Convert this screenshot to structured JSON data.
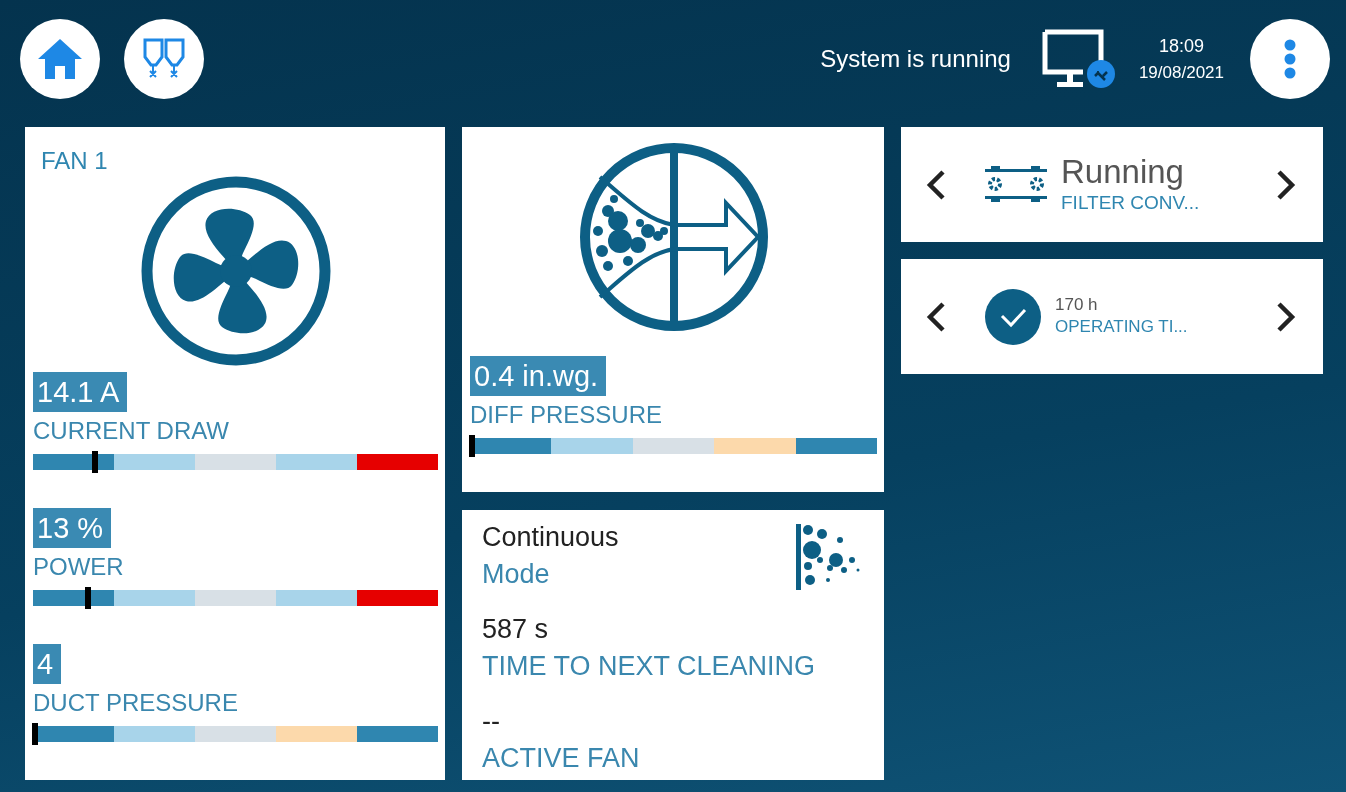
{
  "header": {
    "status": "System is running",
    "time": "18:09",
    "date": "19/08/2021"
  },
  "fan_card": {
    "title": "FAN 1",
    "readings": [
      {
        "value": "14.1 A",
        "label": "CURRENT DRAW",
        "level": 0.147,
        "zones": [
          {
            "color": "#2f86b0"
          },
          {
            "color": "#a8d4ea"
          },
          {
            "color": "#d8e0e6"
          },
          {
            "color": "#a8d4ea"
          },
          {
            "color": "#e60000"
          }
        ]
      },
      {
        "value": "13 %",
        "label": "POWER",
        "level": 0.13,
        "zones": [
          {
            "color": "#2f86b0"
          },
          {
            "color": "#a8d4ea"
          },
          {
            "color": "#d8e0e6"
          },
          {
            "color": "#a8d4ea"
          },
          {
            "color": "#e60000"
          }
        ]
      },
      {
        "value": "4",
        "label": "DUCT PRESSURE",
        "level": 0.0,
        "zones": [
          {
            "color": "#2f86b0"
          },
          {
            "color": "#a8d4ea"
          },
          {
            "color": "#d8e0e6"
          },
          {
            "color": "#fcd9ab"
          },
          {
            "color": "#2f86b0"
          }
        ]
      }
    ]
  },
  "pressure_card": {
    "value": "0.4 in.wg.",
    "label": "DIFF PRESSURE",
    "level": 0.0,
    "zones": [
      {
        "color": "#2f86b0"
      },
      {
        "color": "#a8d4ea"
      },
      {
        "color": "#d8e0e6"
      },
      {
        "color": "#fcd9ab"
      },
      {
        "color": "#2f86b0"
      }
    ]
  },
  "cleaning_card": {
    "items": [
      {
        "value": "Continuous",
        "label": "Mode"
      },
      {
        "value": "587 s",
        "label": "TIME TO NEXT CLEANING"
      },
      {
        "value": "--",
        "label": "ACTIVE FAN"
      }
    ]
  },
  "status_cards": [
    {
      "kind": "conveyor",
      "value": "Running",
      "label": "FILTER CONV..."
    },
    {
      "kind": "check",
      "value": "170 h",
      "label": "OPERATING TI..."
    }
  ]
}
